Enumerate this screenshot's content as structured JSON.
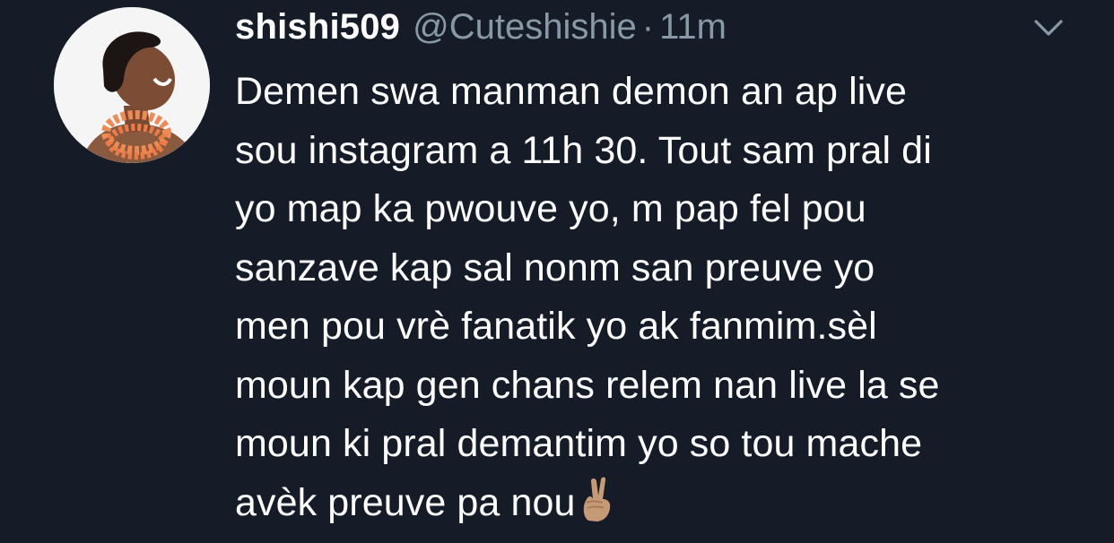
{
  "tweet": {
    "display_name": "shishi509",
    "handle": "@Cuteshishie",
    "separator": "·",
    "time": "11m",
    "lines": [
      "Demen swa manman demon an ap live",
      "sou instagram a 11h 30. Tout sam pral di",
      "yo map ka pwouve yo, m pap fel pou",
      "sanzave kap sal nonm san preuve yo",
      "men pou vrè fanatik yo ak fanmim.sèl",
      "moun kap gen chans relem nan live la se",
      "moun ki pral demantim yo so tou mache",
      "avèk preuve pa nou"
    ],
    "emoji": "victory-hand-emoji",
    "menu_icon": "chevron-down-icon",
    "avatar_icon": "avatar"
  },
  "colors": {
    "background": "#151c27",
    "primary_text": "#ffffff",
    "secondary_text": "#8899a6"
  }
}
